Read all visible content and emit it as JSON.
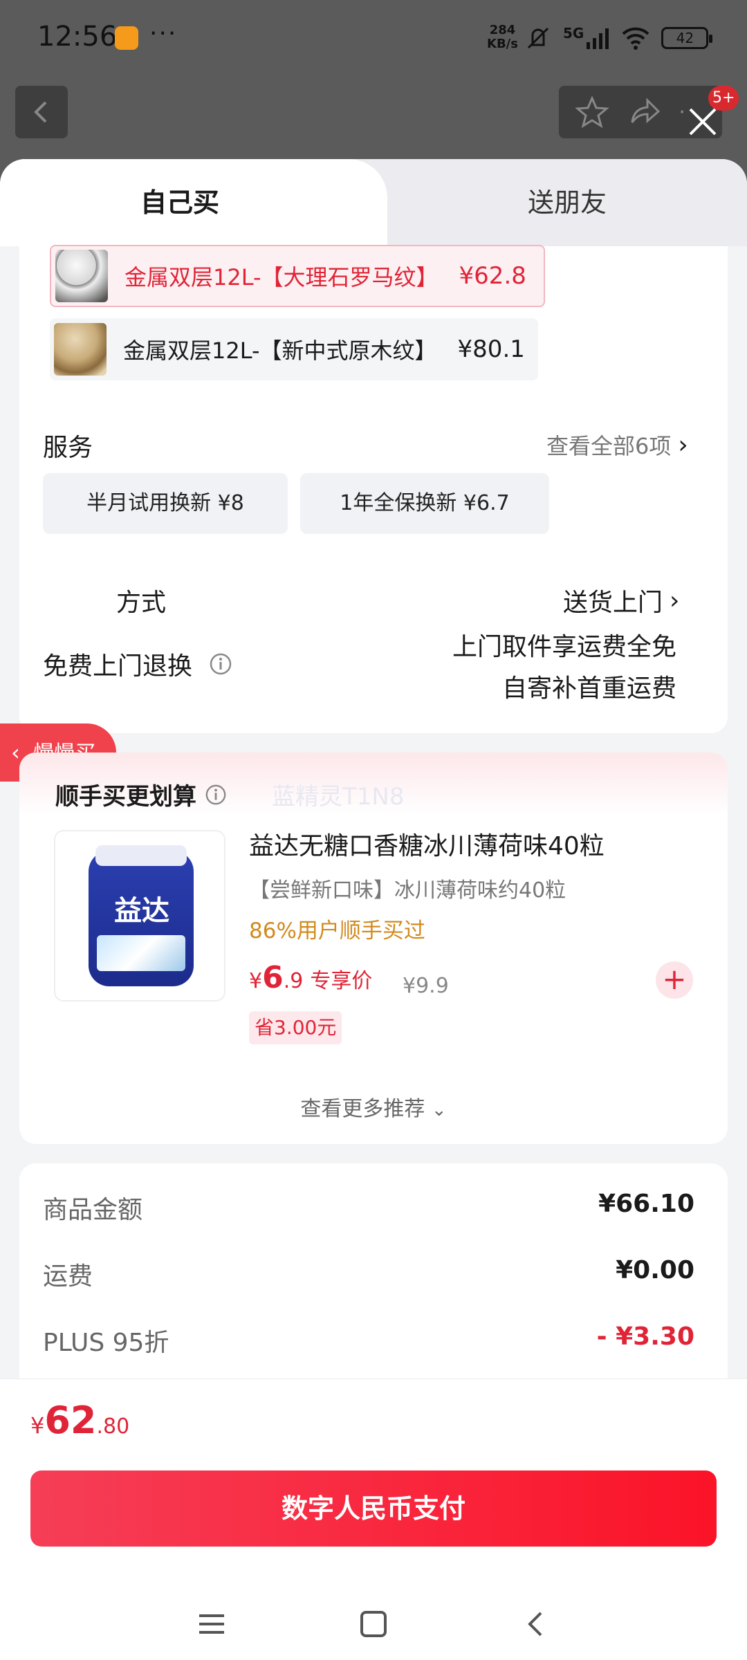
{
  "status_bar": {
    "time": "12:56",
    "more": "···",
    "net_speed_value": "284",
    "net_speed_unit": "KB/s",
    "network": "5G",
    "battery": "42"
  },
  "topbar": {
    "badge": "5+"
  },
  "tabs": {
    "self": "自己买",
    "friend": "送朋友"
  },
  "variants": [
    {
      "name": "金属双层12L-【大理石罗马纹】",
      "price": "¥62.8",
      "selected": true
    },
    {
      "name": "金属双层12L-【新中式原木纹】",
      "price": "¥80.1",
      "selected": false
    }
  ],
  "service": {
    "label": "服务",
    "view_all": "查看全部6项",
    "options": [
      "半月试用换新 ¥8",
      "1年全保换新 ¥6.7"
    ]
  },
  "delivery": {
    "label_visible": "方式",
    "value": "送货上门"
  },
  "slow_buy": "慢慢买",
  "return": {
    "label": "免费上门退换",
    "line1": "上门取件享运费全免",
    "line2": "自寄补首重运费"
  },
  "addon": {
    "title": "顺手买更划算",
    "watermark": "蓝精灵T1N8",
    "product": {
      "name": "益达无糖口香糖冰川薄荷味40粒",
      "subtitle": "【尝鲜新口味】冰川薄荷味约40粒",
      "bought": "86%用户顺手买过",
      "price_currency": "¥",
      "price_int": "6",
      "price_dec": ".9",
      "price_tag": "专享价",
      "original_price": "¥9.9",
      "save": "省3.00元",
      "brand": "益达"
    },
    "more": "查看更多推荐"
  },
  "summary": [
    {
      "label": "商品金额",
      "value": "¥66.10",
      "highlight": false
    },
    {
      "label": "运费",
      "value": "¥0.00",
      "highlight": false
    },
    {
      "label": "PLUS 95折",
      "value": "- ¥3.30",
      "highlight": true
    }
  ],
  "total": {
    "currency": "¥",
    "int": "62",
    "dec": ".80"
  },
  "pay_button": "数字人民币支付",
  "colors": {
    "accent": "#e02437",
    "pay_button": "#fb1328",
    "bought": "#d28a1e"
  },
  "icons": [
    "back-icon",
    "star-icon",
    "share-icon",
    "close-icon",
    "info-icon",
    "chevron-right-icon",
    "plus-icon",
    "menu-icon",
    "home-icon",
    "nav-back-icon"
  ]
}
